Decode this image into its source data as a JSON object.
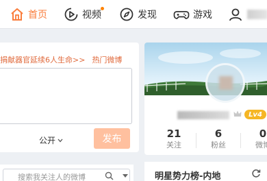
{
  "colors": {
    "accent": "#fa7d3c",
    "publish_bg": "#ffc09f",
    "level_badge": "#f5b625"
  },
  "nav": {
    "items": [
      {
        "label": "首页",
        "icon": "home-icon",
        "active": true
      },
      {
        "label": "视频",
        "icon": "video-icon",
        "badge_dot": true
      },
      {
        "label": "发现",
        "icon": "compass-icon"
      },
      {
        "label": "游戏",
        "icon": "gamepad-icon"
      },
      {
        "icon": "user-icon"
      }
    ]
  },
  "composer": {
    "banner_text": "捐献器官延续6人生命>>",
    "hot_link": "热门微博",
    "visibility": "公开",
    "publish_label": "发布"
  },
  "profile": {
    "level": "Lv4",
    "stats": [
      {
        "value": "21",
        "label": "关注"
      },
      {
        "value": "6",
        "label": "粉丝"
      },
      {
        "value": "0",
        "label": "微博"
      }
    ]
  },
  "search": {
    "placeholder": "搜索我关注人的微博"
  },
  "hot_board": {
    "title": "明星势力榜-内地"
  }
}
